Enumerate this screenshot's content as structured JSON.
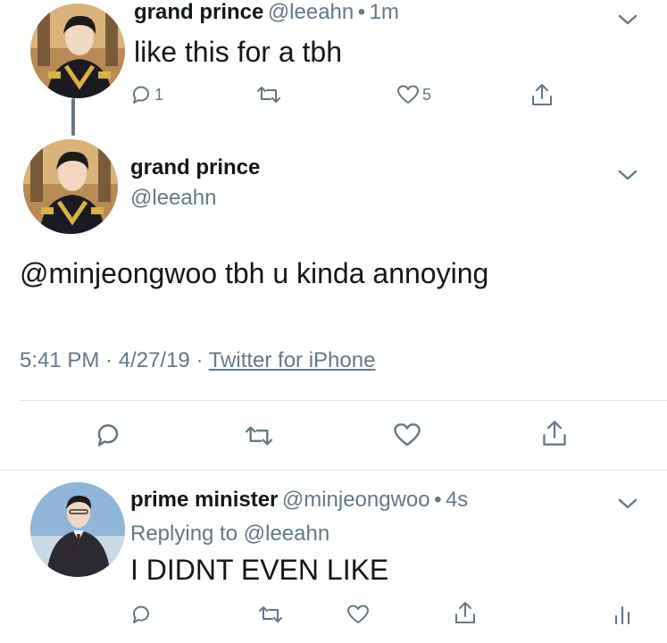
{
  "tweet1": {
    "name": "grand prince",
    "handle": "@leeahn",
    "separator": "•",
    "time": "1m",
    "text": "like this for a tbh",
    "reply_count": "1",
    "like_count": "5"
  },
  "tweet2": {
    "name": "grand prince",
    "handle": "@leeahn",
    "mention": "@minjeongwoo",
    "text": "tbh u kinda annoying",
    "timestamp": "5:41 PM · 4/27/19 ·",
    "source": "Twitter for iPhone"
  },
  "tweet3": {
    "name": "prime minister",
    "handle": "@minjeongwoo",
    "separator": "•",
    "time": "4s",
    "replying_prefix": "Replying to",
    "replying_to": "@leeahn",
    "text": "I DIDNT EVEN LIKE"
  },
  "icons": {
    "reply": "reply-icon",
    "retweet": "retweet-icon",
    "like": "like-icon",
    "share": "share-icon",
    "more": "chevron-down-icon",
    "analytics": "analytics-icon"
  },
  "colors": {
    "text": "#14171a",
    "secondary": "#657786",
    "divider": "#e1e8ed"
  }
}
